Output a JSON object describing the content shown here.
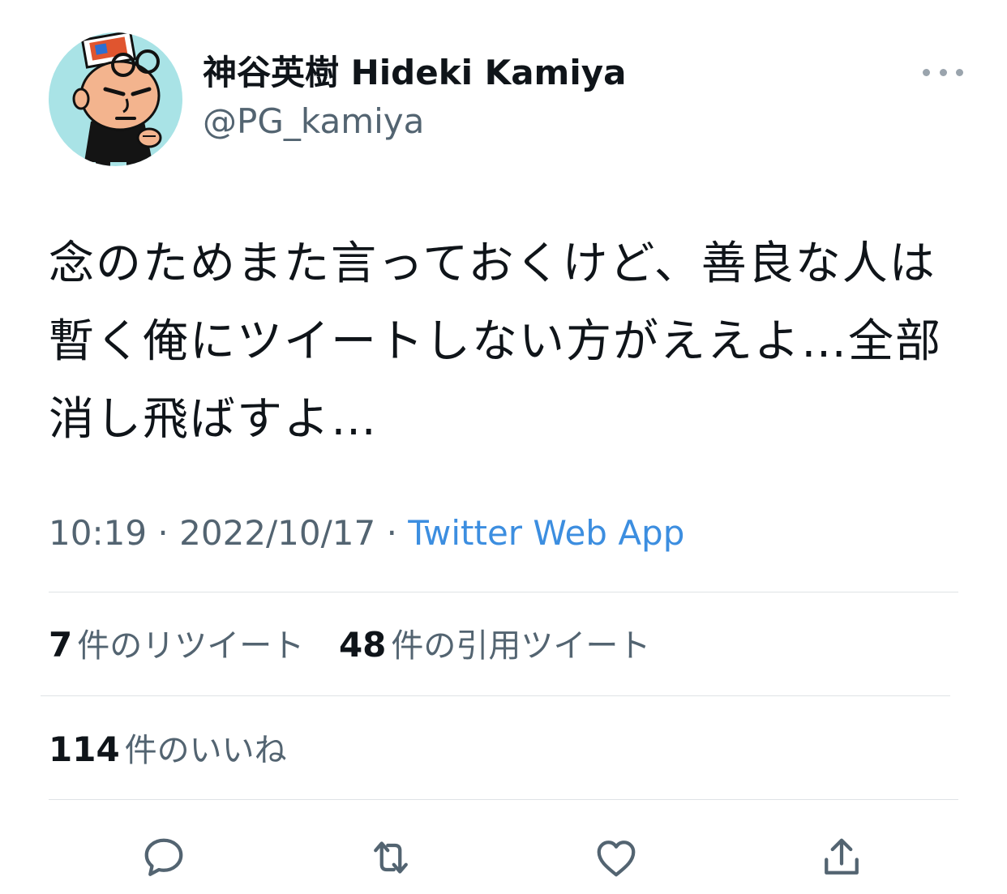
{
  "tweet": {
    "display_name": "神谷英樹 Hideki Kamiya",
    "handle": "@PG_kamiya",
    "text": "念のためまた言っておくけど、善良な人は暫く俺にツイートしない方がええよ…全部消し飛ばすよ…",
    "time": "10:19",
    "date": "2022/10/17",
    "separator": "·",
    "source": "Twitter Web App"
  },
  "stats": {
    "retweets_count": "7",
    "retweets_label": "件のリツイート",
    "quotes_count": "48",
    "quotes_label": "件の引用ツイート",
    "likes_count": "114",
    "likes_label": "件のいいね"
  },
  "icons": {
    "more": "more-icon",
    "reply": "reply-icon",
    "retweet": "retweet-icon",
    "like": "heart-icon",
    "share": "share-icon"
  },
  "colors": {
    "text": "#0f1419",
    "secondary": "#536471",
    "link": "#3c8ee0",
    "icon": "#536471",
    "divider": "#dfe3e6",
    "avatar_bg": "#a9e3e6"
  }
}
